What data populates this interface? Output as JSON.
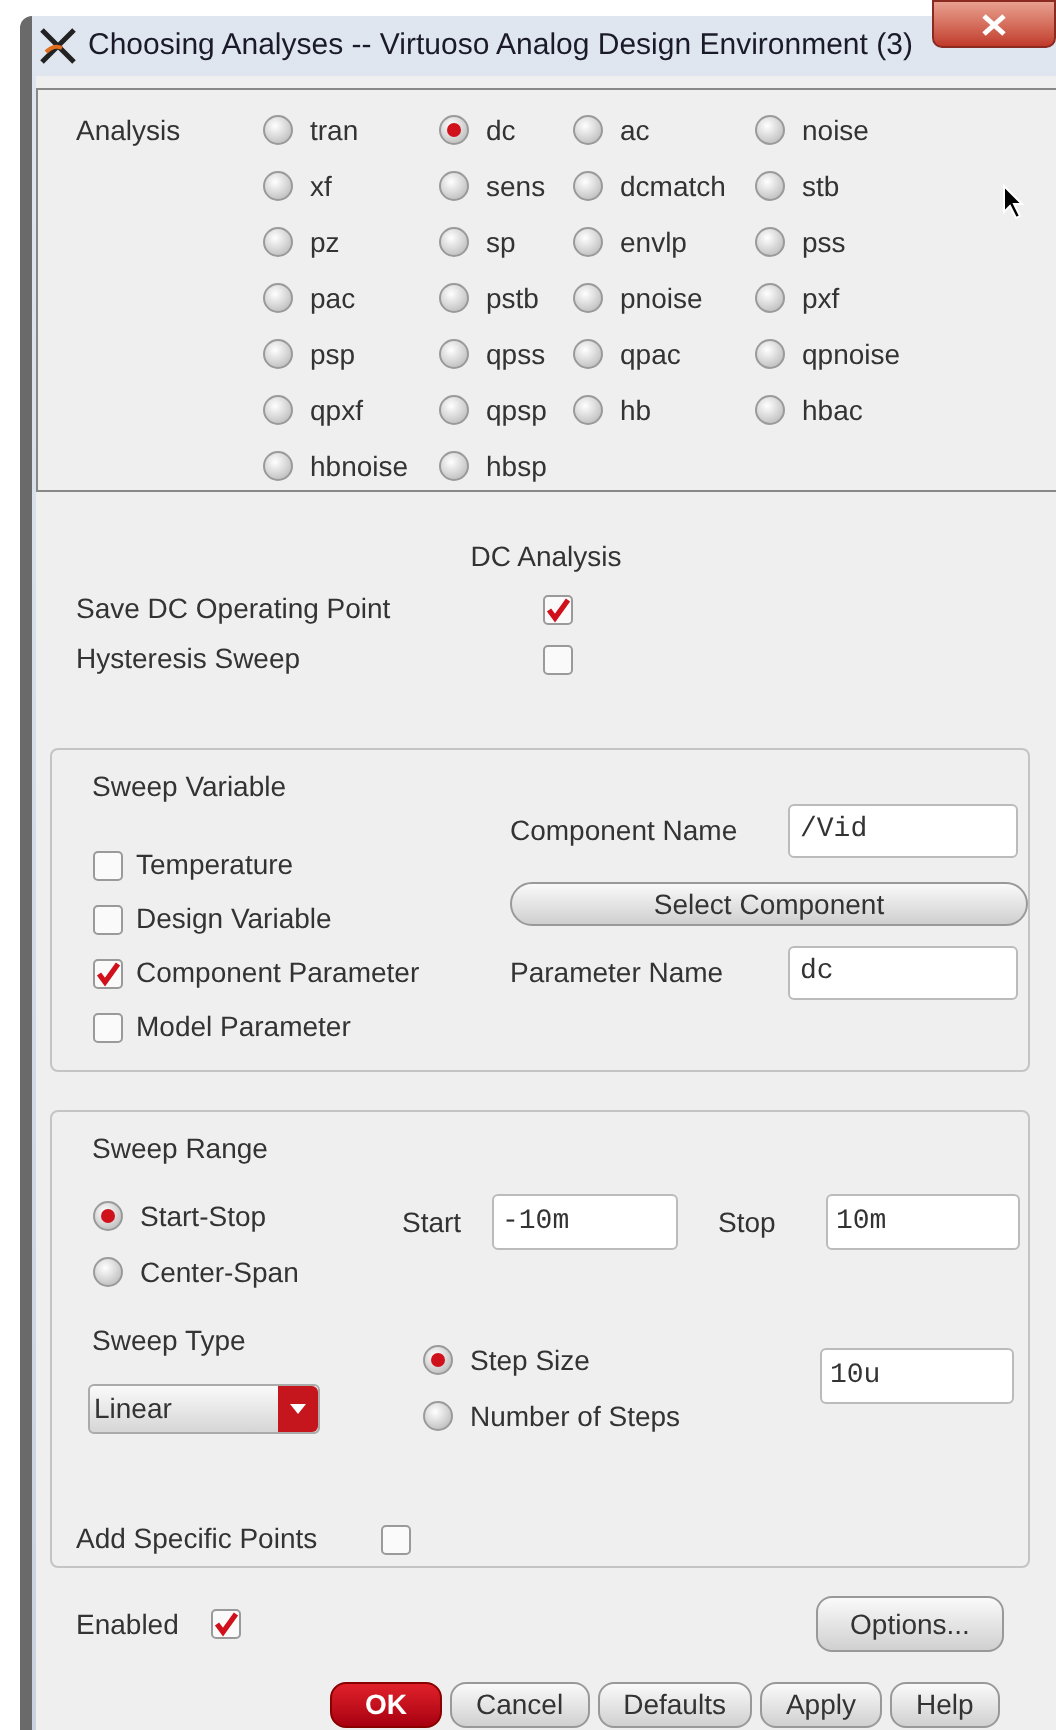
{
  "window": {
    "title": "Choosing Analyses -- Virtuoso Analog Design Environment (3)"
  },
  "analysis": {
    "label": "Analysis",
    "options": [
      {
        "label": "tran",
        "selected": false
      },
      {
        "label": "dc",
        "selected": true
      },
      {
        "label": "ac",
        "selected": false
      },
      {
        "label": "noise",
        "selected": false
      },
      {
        "label": "xf",
        "selected": false
      },
      {
        "label": "sens",
        "selected": false
      },
      {
        "label": "dcmatch",
        "selected": false
      },
      {
        "label": "stb",
        "selected": false
      },
      {
        "label": "pz",
        "selected": false
      },
      {
        "label": "sp",
        "selected": false
      },
      {
        "label": "envlp",
        "selected": false
      },
      {
        "label": "pss",
        "selected": false
      },
      {
        "label": "pac",
        "selected": false
      },
      {
        "label": "pstb",
        "selected": false
      },
      {
        "label": "pnoise",
        "selected": false
      },
      {
        "label": "pxf",
        "selected": false
      },
      {
        "label": "psp",
        "selected": false
      },
      {
        "label": "qpss",
        "selected": false
      },
      {
        "label": "qpac",
        "selected": false
      },
      {
        "label": "qpnoise",
        "selected": false
      },
      {
        "label": "qpxf",
        "selected": false
      },
      {
        "label": "qpsp",
        "selected": false
      },
      {
        "label": "hb",
        "selected": false
      },
      {
        "label": "hbac",
        "selected": false
      },
      {
        "label": "hbnoise",
        "selected": false
      },
      {
        "label": "hbsp",
        "selected": false
      }
    ]
  },
  "section_title": "DC Analysis",
  "dc_options": [
    {
      "label": "Save DC Operating Point",
      "checked": true
    },
    {
      "label": "Hysteresis Sweep",
      "checked": false
    }
  ],
  "sweep_variable": {
    "title": "Sweep Variable",
    "choices": [
      {
        "label": "Temperature",
        "checked": false
      },
      {
        "label": "Design Variable",
        "checked": false
      },
      {
        "label": "Component Parameter",
        "checked": true
      },
      {
        "label": "Model Parameter",
        "checked": false
      }
    ],
    "component_name": {
      "label": "Component Name",
      "value": "/Vid"
    },
    "select_button": "Select Component",
    "parameter_name": {
      "label": "Parameter Name",
      "value": "dc"
    }
  },
  "sweep_range": {
    "title": "Sweep Range",
    "modes": [
      {
        "label": "Start-Stop",
        "selected": true
      },
      {
        "label": "Center-Span",
        "selected": false
      }
    ],
    "start": {
      "label": "Start",
      "value": "-10m"
    },
    "stop": {
      "label": "Stop",
      "value": "10m"
    },
    "sweep_type": {
      "label": "Sweep Type",
      "value": "Linear"
    },
    "step_modes": [
      {
        "label": "Step Size",
        "selected": true
      },
      {
        "label": "Number of Steps",
        "selected": false
      }
    ],
    "step_value": "10u",
    "add_specific_points": {
      "label": "Add Specific Points",
      "checked": false
    }
  },
  "enabled": {
    "label": "Enabled",
    "checked": true
  },
  "options_button": "Options...",
  "buttons": [
    {
      "label": "OK",
      "kind": "primary"
    },
    {
      "label": "Cancel",
      "kind": "normal"
    },
    {
      "label": "Defaults",
      "kind": "normal"
    },
    {
      "label": "Apply",
      "kind": "normal"
    },
    {
      "label": "Help",
      "kind": "normal"
    }
  ]
}
